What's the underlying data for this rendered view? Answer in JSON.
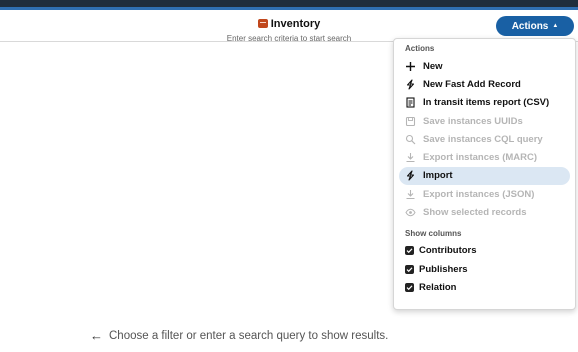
{
  "header": {
    "title": "Inventory",
    "subtitle": "Enter search criteria to start search",
    "actions_label": "Actions"
  },
  "dropdown": {
    "actions_heading": "Actions",
    "items": [
      {
        "label": "New",
        "icon": "plus-icon",
        "disabled": false
      },
      {
        "label": "New Fast Add Record",
        "icon": "lightning-icon",
        "disabled": false
      },
      {
        "label": "In transit items report (CSV)",
        "icon": "report-icon",
        "disabled": false
      },
      {
        "label": "Save instances UUIDs",
        "icon": "save-icon",
        "disabled": true
      },
      {
        "label": "Save instances CQL query",
        "icon": "search-icon",
        "disabled": true
      },
      {
        "label": "Export instances (MARC)",
        "icon": "download-icon",
        "disabled": true
      },
      {
        "label": "Import",
        "icon": "lightning-icon",
        "disabled": false,
        "hovered": true
      },
      {
        "label": "Export instances (JSON)",
        "icon": "download-icon",
        "disabled": true
      },
      {
        "label": "Show selected records",
        "icon": "eye-icon",
        "disabled": true
      }
    ],
    "columns_heading": "Show columns",
    "columns": [
      {
        "label": "Contributors",
        "checked": true
      },
      {
        "label": "Publishers",
        "checked": true
      },
      {
        "label": "Relation",
        "checked": true
      }
    ]
  },
  "empty_message": "Choose a filter or enter a search query to show results.",
  "colors": {
    "accent": "#1960a4",
    "hover": "#dbe7f3",
    "disabled": "#b5b5b5",
    "topbar": "#1f2d3d"
  }
}
